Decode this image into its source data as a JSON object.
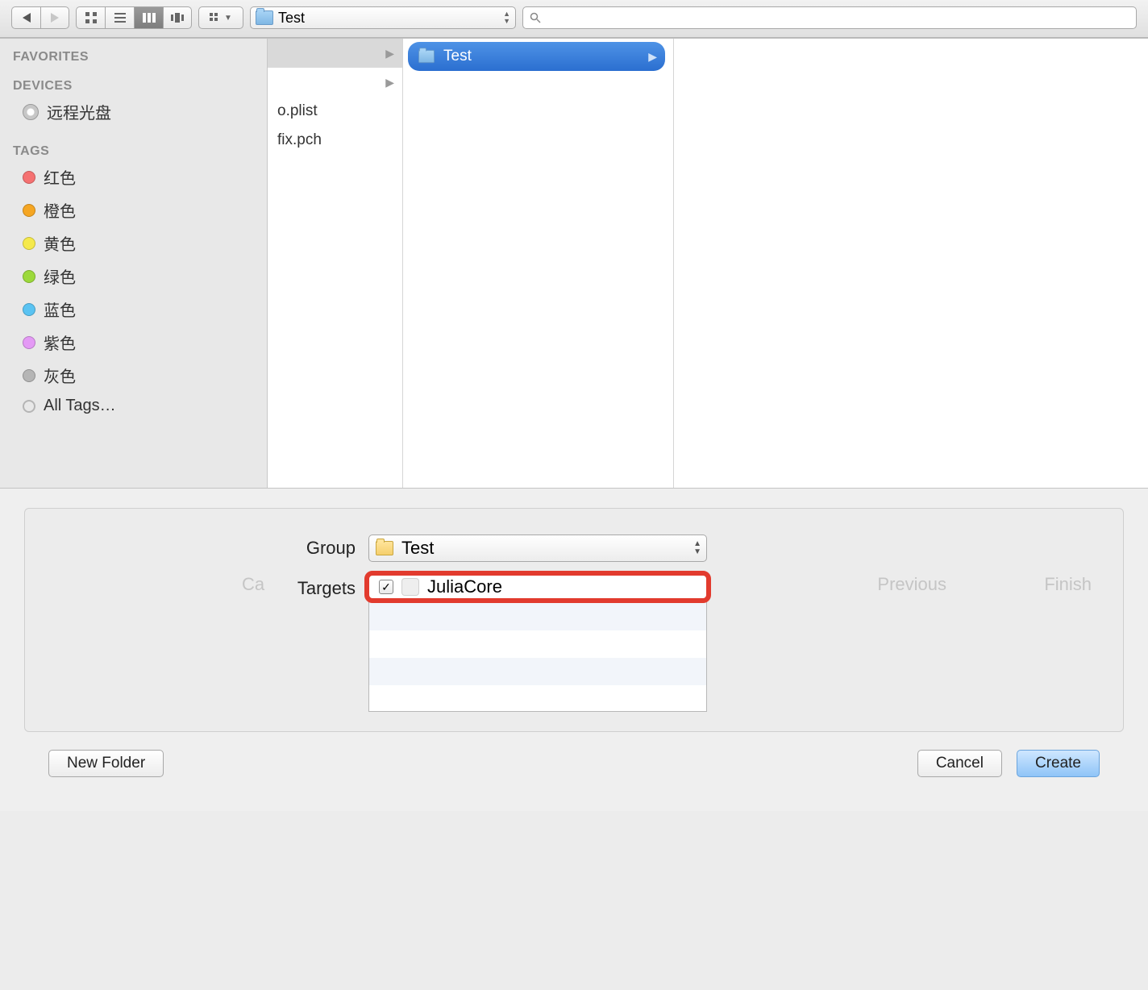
{
  "toolbar": {
    "path_label": "Test",
    "search_placeholder": ""
  },
  "sidebar": {
    "favorites_header": "FAVORITES",
    "devices_header": "DEVICES",
    "devices": [
      {
        "label": "远程光盘"
      }
    ],
    "tags_header": "TAGS",
    "tags": [
      {
        "label": "红色",
        "color": "#f57171"
      },
      {
        "label": "橙色",
        "color": "#f5a623"
      },
      {
        "label": "黄色",
        "color": "#f5e94b"
      },
      {
        "label": "绿色",
        "color": "#9cd93b"
      },
      {
        "label": "蓝色",
        "color": "#5ac3f2"
      },
      {
        "label": "紫色",
        "color": "#e49af5"
      },
      {
        "label": "灰色",
        "color": "#b5b5b5"
      }
    ],
    "all_tags_label": "All Tags…"
  },
  "columns": {
    "col1_items": [
      {
        "label": "",
        "selected": true
      },
      {
        "label": ""
      },
      {
        "label": "o.plist"
      },
      {
        "label": "fix.pch"
      }
    ],
    "col2_items": [
      {
        "label": "Test",
        "selected": true
      }
    ]
  },
  "options": {
    "group_label": "Group",
    "group_value": "Test",
    "targets_label": "Targets",
    "targets": [
      {
        "label": "JuliaCore",
        "checked": true
      }
    ]
  },
  "ghost": {
    "previous": "Previous",
    "finish": "Finish",
    "cancel_like": "Ca"
  },
  "footer": {
    "new_folder": "New Folder",
    "cancel": "Cancel",
    "create": "Create"
  }
}
